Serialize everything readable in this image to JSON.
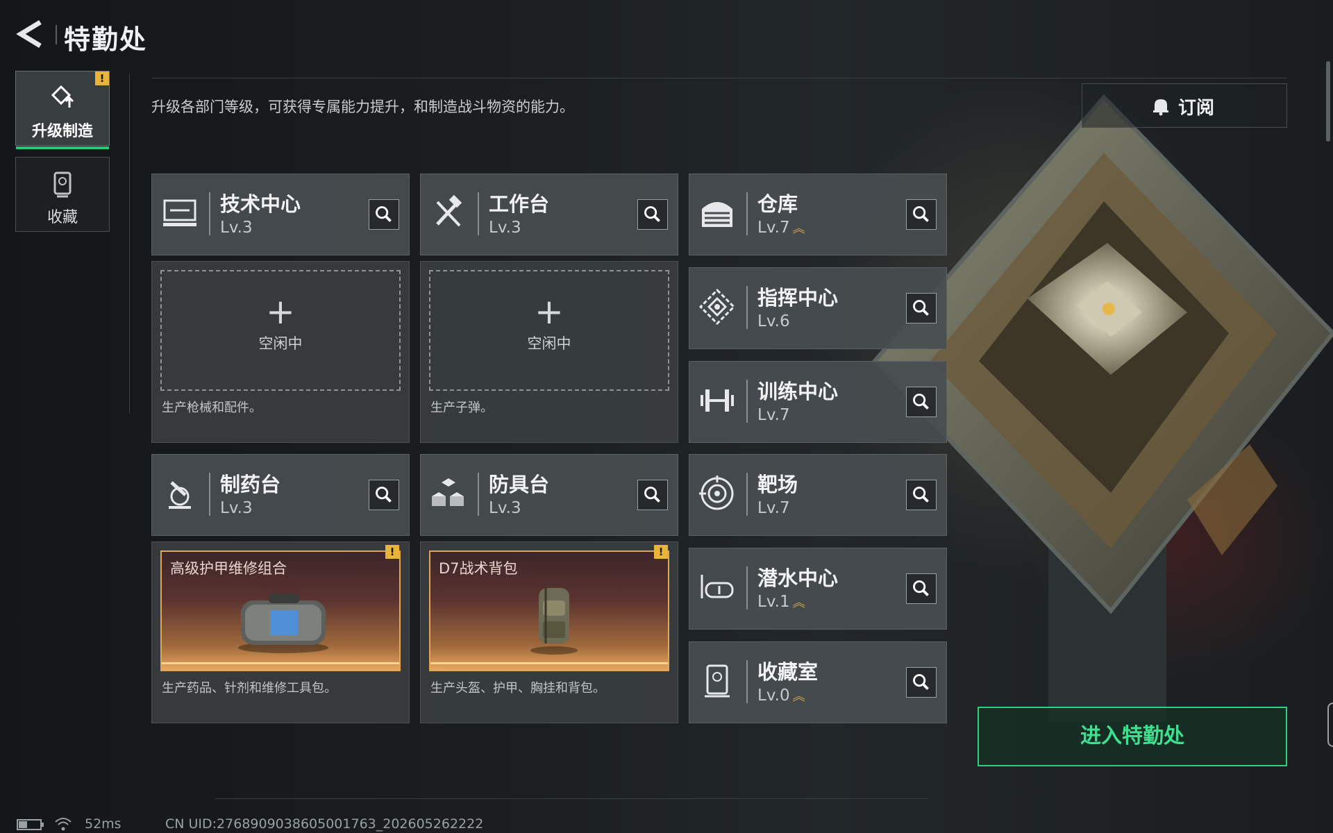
{
  "header": {
    "title": "特勤处"
  },
  "side_tabs": [
    {
      "label": "升级制造",
      "badge": "!"
    },
    {
      "label": "收藏"
    }
  ],
  "description": "升级各部门等级，可获得专属能力提升，和制造战斗物资的能力。",
  "subscribe_label": "订阅",
  "departments": [
    {
      "name": "技术中心",
      "level": "Lv.3"
    },
    {
      "name": "工作台",
      "level": "Lv.3"
    },
    {
      "name": "仓库",
      "level": "Lv.7",
      "upgradable": true
    },
    {
      "name": "指挥中心",
      "level": "Lv.6"
    },
    {
      "name": "训练中心",
      "level": "Lv.7"
    },
    {
      "name": "制药台",
      "level": "Lv.3"
    },
    {
      "name": "防具台",
      "level": "Lv.3"
    },
    {
      "name": "靶场",
      "level": "Lv.7"
    },
    {
      "name": "潜水中心",
      "level": "Lv.1",
      "upgradable": true
    },
    {
      "name": "收藏室",
      "level": "Lv.0",
      "upgradable": true
    }
  ],
  "production": [
    {
      "status": "空闲中",
      "plus": "+",
      "caption": "生产枪械和配件。"
    },
    {
      "status": "空闲中",
      "plus": "+",
      "caption": "生产子弹。"
    },
    {
      "item": "高级护甲维修组合",
      "badge": "!",
      "caption": "生产药品、针剂和维修工具包。"
    },
    {
      "item": "D7战术背包",
      "badge": "!",
      "caption": "生产头盔、护甲、胸挂和背包。"
    }
  ],
  "enter_button": "进入特勤处",
  "status_bar": {
    "ping": "52ms",
    "uid": "CN UID:2768909038605001763_202605262222"
  },
  "colors": {
    "accent_green": "#2fd07e",
    "badge_yellow": "#e8b43a",
    "upgrade_gold": "#d9a84a"
  }
}
